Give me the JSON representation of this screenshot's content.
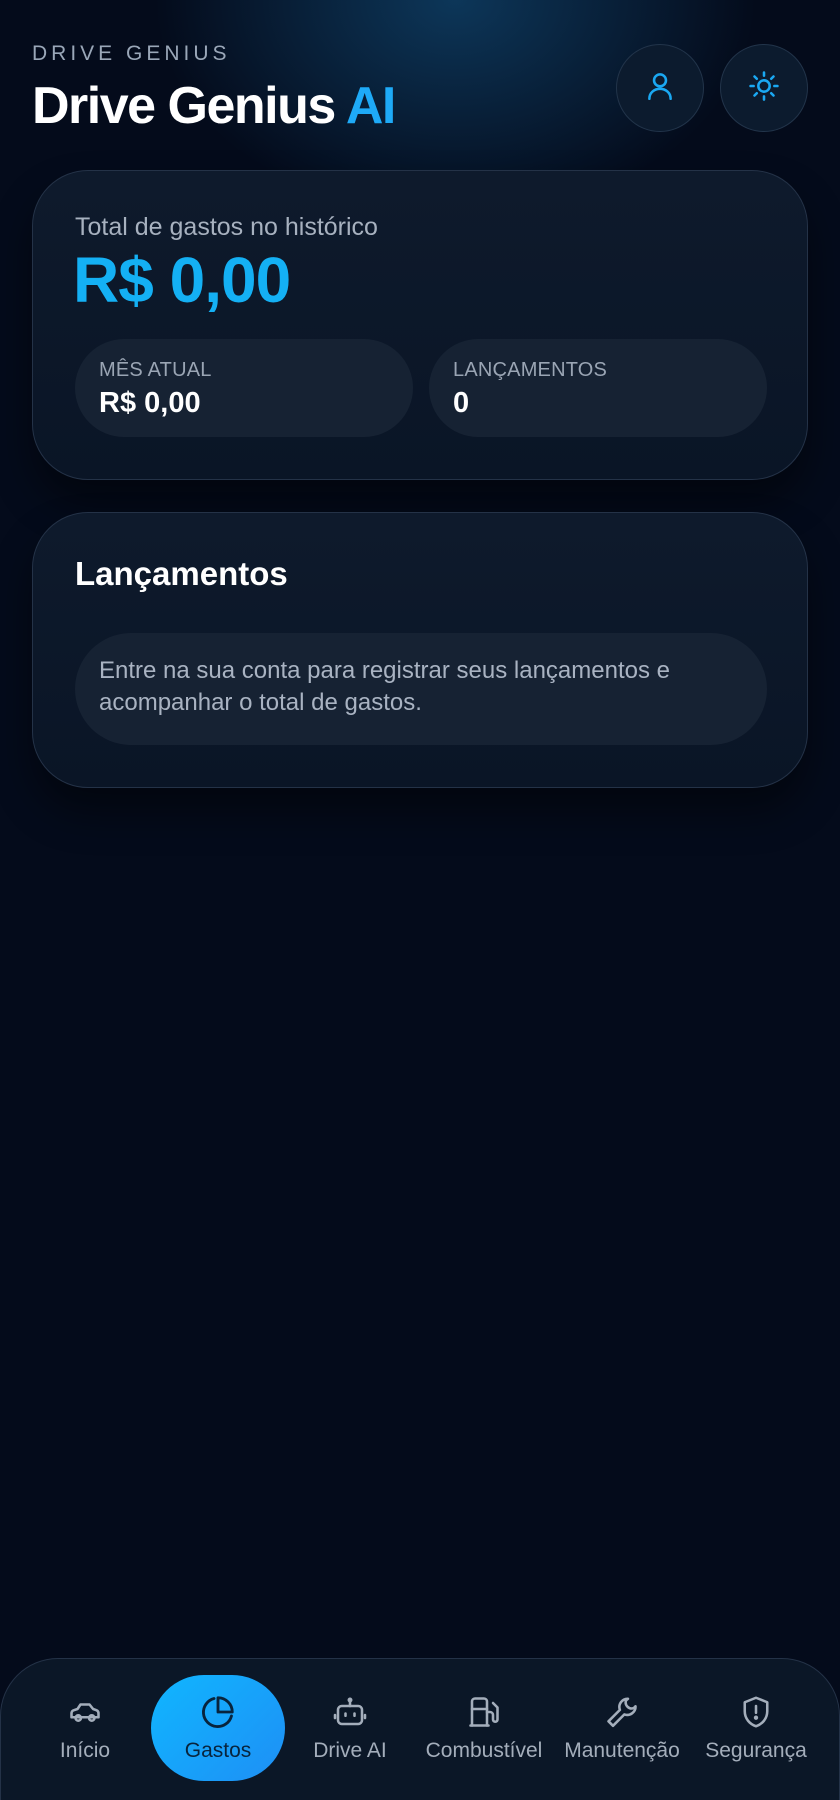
{
  "header": {
    "kicker": "DRIVE GENIUS",
    "title_main": "Drive Genius",
    "title_accent": "AI",
    "user_icon": "user-icon",
    "theme_icon": "sun-icon"
  },
  "summary": {
    "total_label": "Total de gastos no histórico",
    "total_value": "R$ 0,00",
    "month_label": "MÊS ATUAL",
    "month_value": "R$ 0,00",
    "count_label": "LANÇAMENTOS",
    "count_value": "0"
  },
  "entries": {
    "title": "Lançamentos",
    "empty_message": "Entre na sua conta para registrar seus lançamentos e acompanhar o total de gastos."
  },
  "nav": {
    "items": [
      {
        "label": "Início",
        "icon": "car-icon",
        "active": false
      },
      {
        "label": "Gastos",
        "icon": "pie-chart-icon",
        "active": true
      },
      {
        "label": "Drive AI",
        "icon": "robot-icon",
        "active": false
      },
      {
        "label": "Combustível",
        "icon": "fuel-pump-icon",
        "active": false
      },
      {
        "label": "Manutenção",
        "icon": "wrench-icon",
        "active": false
      },
      {
        "label": "Segurança",
        "icon": "shield-alert-icon",
        "active": false
      }
    ]
  },
  "colors": {
    "accent": "#14b0f4",
    "background": "#040b1b",
    "card": "#0e1a2c",
    "active_nav": "#10b6ff"
  }
}
